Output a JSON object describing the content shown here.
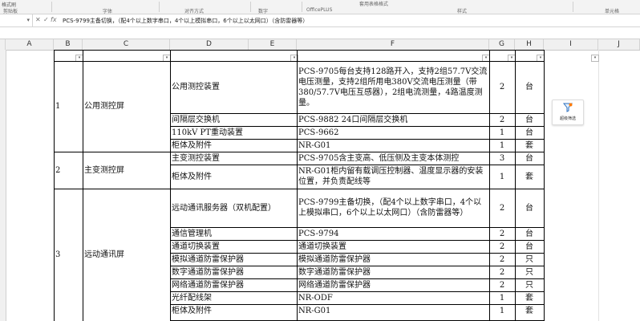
{
  "ribbon": {
    "top_label": "格式刷",
    "groups": [
      "剪贴板",
      "字体",
      "对齐方式",
      "数字",
      "OfficePLUS",
      "样式",
      "单元格"
    ],
    "partial_label": "套用表格格式"
  },
  "formula_bar": {
    "name_box": "",
    "cancel_icon": "✕",
    "enter_icon": "✓",
    "fx": "fx",
    "content": "PCS-9799主备切换，（配4个以上数字串口，4个以上模拟串口，6个以上以太网口）（含防雷器等）"
  },
  "columns": [
    "A",
    "B",
    "C",
    "D",
    "E",
    "F",
    "G",
    "H",
    "I",
    "J"
  ],
  "filter_icon": "▾",
  "sections": [
    {
      "no": "1",
      "name": "公用测控屏"
    },
    {
      "no": "2",
      "name": "主变测控屏"
    },
    {
      "no": "3",
      "name": "远动通讯屏"
    }
  ],
  "rows": [
    {
      "item": "公用测控装置",
      "spec": "PCS-9705每台支持128路开入，支持2组57.7V交流电压测量，支持2组所用电380V交流电压测量（带380/57.7V电压互感器），2组电流测量，4路温度测量。",
      "qty": "2",
      "unit": "台"
    },
    {
      "item": "间隔层交换机",
      "spec": "PCS-9882 24口间隔层交换机",
      "qty": "2",
      "unit": "台"
    },
    {
      "item": "110kV PT重动装置",
      "spec": "PCS-9662",
      "qty": "1",
      "unit": "台"
    },
    {
      "item": "柜体及附件",
      "spec": "NR-G01",
      "qty": "1",
      "unit": "套"
    },
    {
      "item": "主变测控装置",
      "spec": "PCS-9705含主变高、低压侧及主变本体测控",
      "qty": "3",
      "unit": "台"
    },
    {
      "item": "柜体及附件",
      "spec": "NR-G01柜内留有载调压控制器、温度显示器的安装位置，并负责配线等",
      "qty": "1",
      "unit": "套"
    },
    {
      "item": "远动通讯服务器（双机配置）",
      "spec": "PCS-9799主备切换，（配4个以上数字串口，4个以上模拟串口，6个以上以太网口）（含防雷器等）",
      "qty": "2",
      "unit": "台"
    },
    {
      "item": "通信管理机",
      "spec": "PCS-9794",
      "qty": "2",
      "unit": "台"
    },
    {
      "item": "通道切换装置",
      "spec": "通道切换装置",
      "qty": "2",
      "unit": "台"
    },
    {
      "item": "模拟通道防雷保护器",
      "spec": "模拟通道防雷保护器",
      "qty": "2",
      "unit": "只"
    },
    {
      "item": "数字通道防雷保护器",
      "spec": "数字通道防雷保护器",
      "qty": "2",
      "unit": "只"
    },
    {
      "item": "网络通道防雷保护器",
      "spec": "网络通道防雷保护器",
      "qty": "2",
      "unit": "只"
    },
    {
      "item": "光纤配线架",
      "spec": "NR-ODF",
      "qty": "1",
      "unit": "套"
    },
    {
      "item": "柜体及附件",
      "spec": "NR-G01",
      "qty": "1",
      "unit": "套"
    }
  ],
  "float_button": {
    "label": "超级筛选"
  }
}
